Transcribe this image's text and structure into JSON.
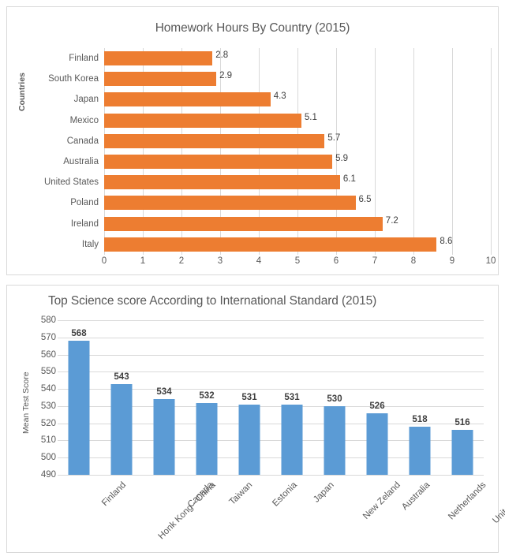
{
  "chart_data": [
    {
      "id": "homework-hours",
      "type": "bar",
      "orientation": "horizontal",
      "title": "Homework Hours By Country (2015)",
      "xlabel": "",
      "ylabel": "Countries",
      "xlim": [
        0,
        10
      ],
      "xticks": [
        "0",
        "1",
        "2",
        "3",
        "4",
        "5",
        "6",
        "7",
        "8",
        "9",
        "10"
      ],
      "grid": "vertical",
      "legend": "none",
      "series_color": "#ED7D31",
      "categories": [
        "Finland",
        "South Korea",
        "Japan",
        "Mexico",
        "Canada",
        "Australia",
        "United States",
        "Poland",
        "Ireland",
        "Italy"
      ],
      "values": [
        2.8,
        2.9,
        4.3,
        5.1,
        5.7,
        5.9,
        6.1,
        6.5,
        7.2,
        8.6
      ],
      "value_labels": [
        "2.8",
        "2.9",
        "4.3",
        "5.1",
        "5.7",
        "5.9",
        "6.1",
        "6.5",
        "7.2",
        "8.6"
      ]
    },
    {
      "id": "science-score",
      "type": "bar",
      "orientation": "vertical",
      "title": "Top Science score According to International Standard (2015)",
      "xlabel": "",
      "ylabel": "Mean Test Score",
      "ylim": [
        490,
        580
      ],
      "yticks": [
        "490",
        "500",
        "510",
        "520",
        "530",
        "540",
        "550",
        "560",
        "570",
        "580"
      ],
      "grid": "horizontal",
      "legend": "none",
      "series_color": "#5B9BD5",
      "categories": [
        "Finland",
        "Honk Kong - China",
        "Canada",
        "Taiwan",
        "Estonia",
        "Japan",
        "New Zeland",
        "Australia",
        "Netherlands",
        "United States"
      ],
      "values": [
        568,
        543,
        534,
        532,
        531,
        531,
        530,
        526,
        518,
        516
      ],
      "value_labels": [
        "568",
        "543",
        "534",
        "532",
        "531",
        "531",
        "530",
        "526",
        "518",
        "516"
      ]
    }
  ]
}
